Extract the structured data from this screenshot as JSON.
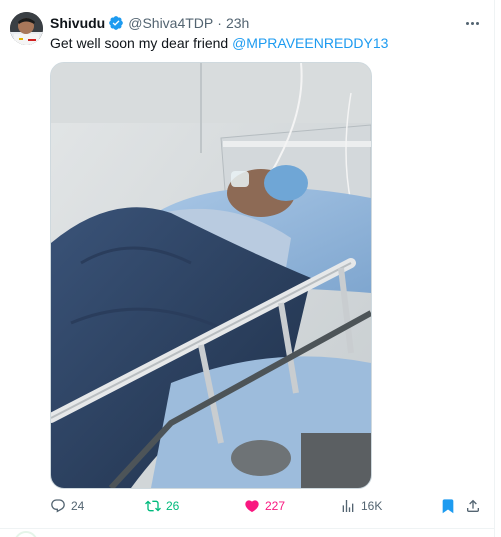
{
  "tweet": {
    "display_name": "Shivudu",
    "handle": "@Shiva4TDP",
    "separator": "·",
    "time": "23h",
    "text_before": "Get well soon my dear friend ",
    "mention": "@MPRAVEENREDDY13"
  },
  "actions": {
    "replies": "24",
    "retweets": "26",
    "likes": "227",
    "views": "16K"
  },
  "icons": {
    "verified": "verified-badge-icon",
    "more": "more-horizontal-icon",
    "reply": "reply-icon",
    "retweet": "retweet-icon",
    "like": "heart-filled-icon",
    "views": "views-chart-icon",
    "bookmark": "bookmark-filled-icon",
    "share": "share-icon"
  },
  "colors": {
    "accent": "#1d9bf0",
    "retweet_active": "#00ba7c",
    "like_active": "#f91880",
    "muted_text": "#536471"
  }
}
